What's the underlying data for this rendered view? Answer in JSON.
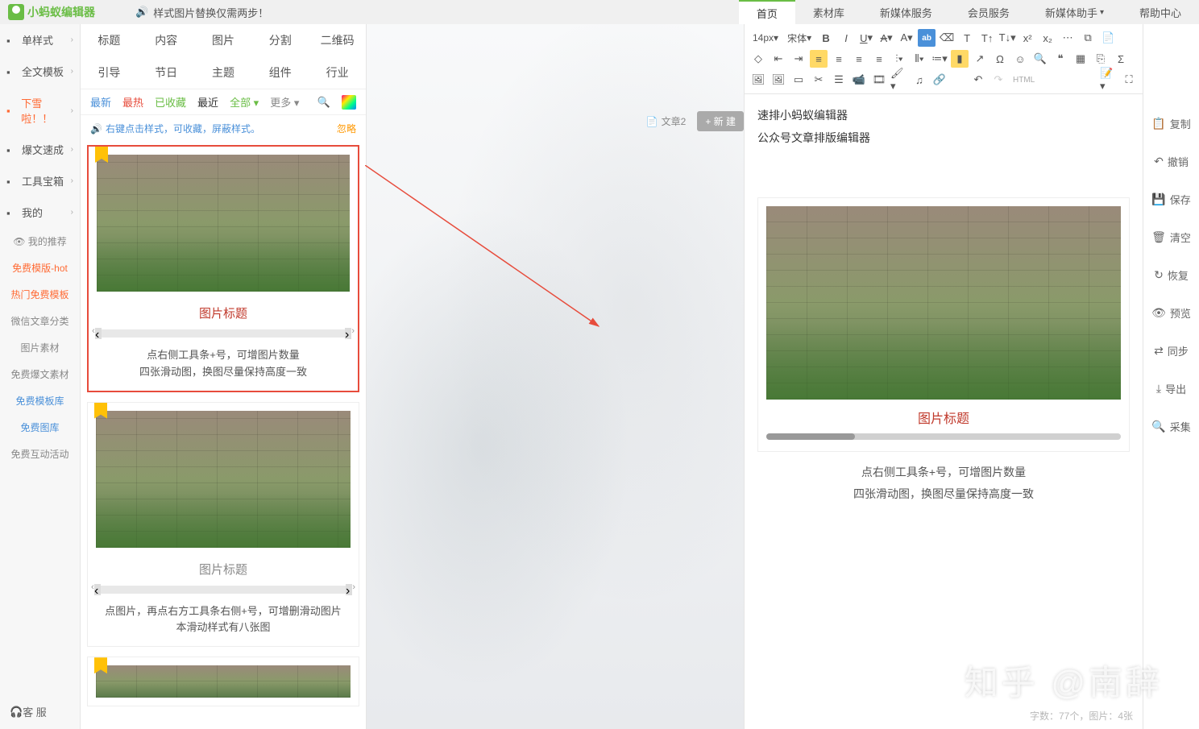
{
  "logo": "小蚂蚁编辑器",
  "announcement": "样式图片替换仅需两步！",
  "topNav": {
    "items": [
      "首页",
      "素材库",
      "新媒体服务",
      "会员服务",
      "新媒体助手",
      "帮助中心"
    ],
    "activeIndex": 0
  },
  "sidebar": {
    "main": [
      {
        "label": "单样式",
        "icon": "grid"
      },
      {
        "label": "全文模板",
        "icon": "template"
      },
      {
        "label": "下雪啦！！",
        "icon": "snow",
        "highlight": true
      },
      {
        "label": "爆文速成",
        "icon": "fire"
      },
      {
        "label": "工具宝箱",
        "icon": "box"
      },
      {
        "label": "我的",
        "icon": "user"
      }
    ],
    "subs": [
      {
        "label": "我的推荐",
        "style": "gray"
      },
      {
        "label": "免费模版-hot",
        "style": "orange"
      },
      {
        "label": "热门免费模板",
        "style": "orange"
      },
      {
        "label": "微信文章分类",
        "style": "gray"
      },
      {
        "label": "图片素材",
        "style": "gray"
      },
      {
        "label": "免费爆文素材",
        "style": "gray"
      },
      {
        "label": "免费模板库",
        "style": "blue"
      },
      {
        "label": "免费图库",
        "style": "blue"
      },
      {
        "label": "免费互动活动",
        "style": "gray"
      }
    ],
    "service": "客 服"
  },
  "categories": {
    "row1": [
      "标题",
      "内容",
      "图片",
      "分割",
      "二维码"
    ],
    "row2": [
      "引导",
      "节日",
      "主题",
      "组件",
      "行业"
    ]
  },
  "filters": {
    "items": [
      {
        "label": "最新",
        "cls": "fr-blue"
      },
      {
        "label": "最热",
        "cls": "fr-red"
      },
      {
        "label": "已收藏",
        "cls": "fr-green"
      },
      {
        "label": "最近",
        "cls": "fr-dark"
      },
      {
        "label": "全部 ▾",
        "cls": "fr-green"
      },
      {
        "label": "更多 ▾",
        "cls": "fr-gray"
      }
    ]
  },
  "tip": {
    "text": "右键点击样式，可收藏，屏蔽样式。",
    "ignore": "忽略"
  },
  "styleCards": [
    {
      "title": "图片标题",
      "titleCls": "red",
      "selected": true,
      "desc1": "点右侧工具条+号，可增图片数量",
      "desc2": "四张滑动图，换图尽量保持高度一致"
    },
    {
      "title": "图片标题",
      "titleCls": "gray",
      "selected": false,
      "desc1": "点图片，再点右方工具条右侧+号，可增删滑动图片",
      "desc2": "本滑动样式有八张图"
    }
  ],
  "docTab": {
    "label": "文章2",
    "newBtn": "+ 新 建"
  },
  "toolbar": {
    "fontSize": "14px",
    "fontFamily": "宋体"
  },
  "editorContent": {
    "line1": "速排小蚂蚁编辑器",
    "line2": "公众号文章排版编辑器",
    "cardTitle": "图片标题",
    "desc1": "点右侧工具条+号，可增图片数量",
    "desc2": "四张滑动图，换图尽量保持高度一致"
  },
  "statusBar": "字数：77个，图片：4张",
  "actions": [
    {
      "label": "复制",
      "icon": "📋"
    },
    {
      "label": "撤销",
      "icon": "↶"
    },
    {
      "label": "保存",
      "icon": "💾"
    },
    {
      "label": "清空",
      "icon": "🗑"
    },
    {
      "label": "恢复",
      "icon": "↻"
    },
    {
      "label": "预览",
      "icon": "👁"
    },
    {
      "label": "同步",
      "icon": "⇄"
    },
    {
      "label": "导出",
      "icon": "⤓"
    },
    {
      "label": "采集",
      "icon": "🔍"
    }
  ],
  "watermark": "知乎 @南辞"
}
